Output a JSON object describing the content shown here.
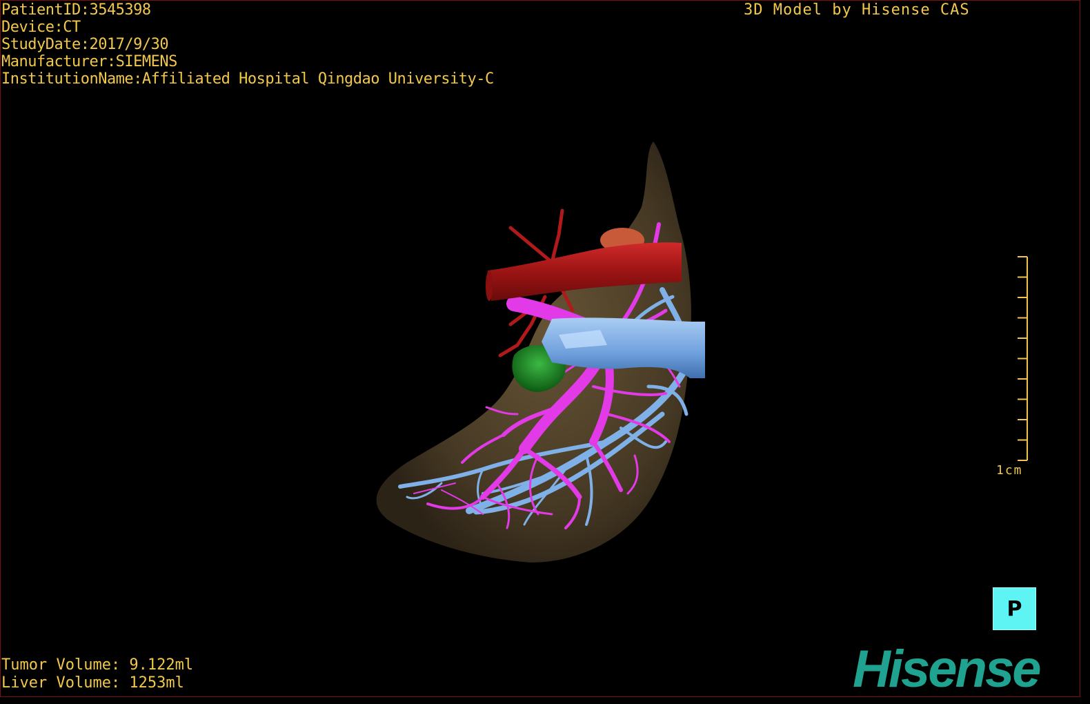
{
  "overlay": {
    "patient_id": "PatientID:3545398",
    "device": "Device:CT",
    "study_date": "StudyDate:2017/9/30",
    "manufacturer": "Manufacturer:SIEMENS",
    "institution": "InstitutionName:Affiliated Hospital Qingdao University-C",
    "credit": "3D Model by Hisense CAS",
    "tumor_volume": "Tumor Volume: 9.122ml",
    "liver_volume": "Liver Volume: 1253ml",
    "scale_label": "1cm",
    "orientation_label": "P",
    "logo_text": "Hisense"
  },
  "colors": {
    "overlay_text": "#f2c84b",
    "liver": "#5a4a30",
    "artery": "#b01a1a",
    "portal_vein": "#e23ae6",
    "hepatic_vein": "#7fb0e8",
    "tumor": "#1d8a22",
    "gallbladder": "#c85a3a",
    "orientation_button": "#5ff4f4",
    "logo": "#1fa28f"
  },
  "icons": {
    "orientation": "posterior-view-cube-icon"
  }
}
